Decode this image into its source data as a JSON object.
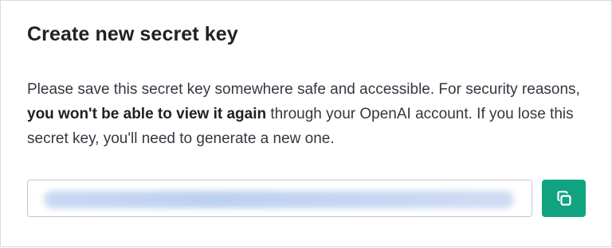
{
  "dialog": {
    "title": "Create new secret key",
    "description_start": "Please save this secret key somewhere safe and accessible. For security reasons, ",
    "description_bold": "you won't be able to view it again",
    "description_end": " through your OpenAI account. If you lose this secret key, you'll need to generate a new one."
  },
  "key_field": {
    "icon": "copy-icon"
  },
  "colors": {
    "accent": "#10a37f",
    "text": "#353740",
    "title": "#202123",
    "border": "#c5c5d2"
  }
}
